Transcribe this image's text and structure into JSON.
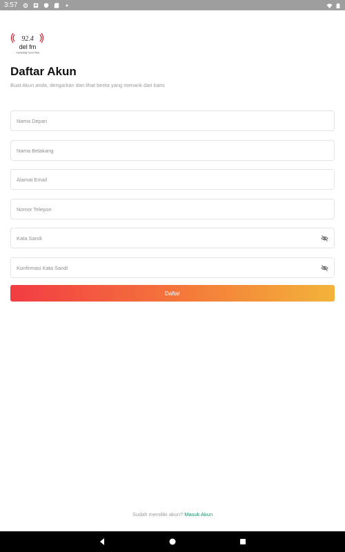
{
  "status_bar": {
    "time": "3:57",
    "icons": [
      "settings-icon",
      "notification-icon",
      "shield-icon",
      "sd-card-icon",
      "dot-icon",
      "wifi-icon",
      "battery-icon"
    ]
  },
  "logo": {
    "frequency": "92.4",
    "name": "del fm",
    "tagline": "Connecting You to Toba",
    "accent_color": "#c8202f"
  },
  "form": {
    "title": "Daftar Akun",
    "subtitle": "Buat Akun anda, dengarkan dan lihat berita yang menarik dari kami",
    "fields": [
      {
        "placeholder": "Nama Depan",
        "value": ""
      },
      {
        "placeholder": "Nama Belakang",
        "value": ""
      },
      {
        "placeholder": "Alamat Email",
        "value": ""
      },
      {
        "placeholder": "Nomor Telepon",
        "value": ""
      },
      {
        "placeholder": "Kata Sandi",
        "value": "",
        "icon": "eye-off-icon"
      },
      {
        "placeholder": "Konfirmasi Kata Sandi",
        "value": "",
        "icon": "eye-off-icon"
      }
    ],
    "submit_label": "Daftar",
    "gradient_colors": [
      "#f23c43",
      "#f2b33a"
    ]
  },
  "footer": {
    "question": "Sudah memiliki akun?",
    "login_link": "Masuk Akun",
    "link_color": "#1f8f6a"
  },
  "nav": {
    "buttons": [
      "back-icon",
      "home-icon",
      "recents-icon"
    ]
  }
}
